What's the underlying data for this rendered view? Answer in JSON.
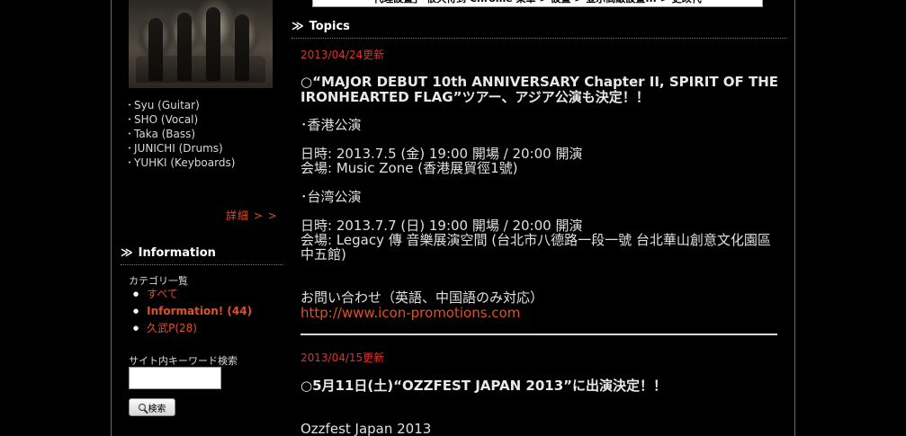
{
  "notice_bar": {
    "text": "代理設置」 很久待到 Chrome 菜單 > 設置 > 並示高級設置... > 更改代"
  },
  "sidebar": {
    "members": [
      "Syu (Guitar)",
      "SHO (Vocal)",
      "Taka (Bass)",
      "JUNICHI (Drums)",
      "YUHKI (Keyboards)"
    ],
    "details_link": "詳細 > >",
    "information": {
      "heading": "Information",
      "category_label": "カテゴリ一覧",
      "categories": [
        {
          "label": "すべて"
        },
        {
          "label": "Information! (44)"
        },
        {
          "label": "久武P(28)"
        }
      ]
    },
    "search": {
      "label": "サイト内キーワード検索",
      "value": "",
      "button_label": "検索"
    }
  },
  "main": {
    "heading": "Topics",
    "posts": [
      {
        "date": "2013/04/24更新",
        "title": "○“MAJOR DEBUT 10th ANNIVERSARY Chapter II, SPIRIT OF THE IRONHEARTED FLAG”ツアー、アジア公演も決定！！",
        "hk_heading": "･香港公演",
        "hk_datetime": "日時: 2013.7.5 (金) 19:00 開場 / 20:00 開演",
        "hk_venue": "会場: Music Zone (香港展貿徑1號)",
        "tw_heading": "･台湾公演",
        "tw_datetime": "日時: 2013.7.7 (日) 19:00 開場 / 20:00 開演",
        "tw_venue": "会場: Legacy 傳 音樂展演空間 (台北市八德路一段一號 台北華山創意文化園區中五館)",
        "contact_label": "お問い合わせ（英語、中国語のみ対応）",
        "contact_link": "http://www.icon-promotions.com"
      },
      {
        "date": "2013/04/15更新",
        "title": "○5月11日(土)“OZZFEST JAPAN 2013”に出演決定！！",
        "body_start": "Ozzfest Japan 2013"
      }
    ]
  },
  "colors": {
    "background": "#000000",
    "accent_link": "#e0502a",
    "date_red": "#e0302a"
  }
}
